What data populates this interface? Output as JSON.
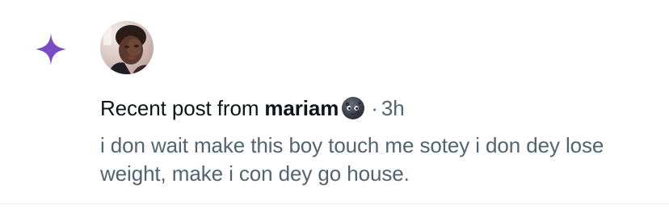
{
  "notification": {
    "headline_prefix": "Recent post from",
    "author_name": "mariam",
    "author_emoji_icon": "new-moon-face-icon",
    "separator": "·",
    "time_ago": "3h",
    "post_text": "i don wait make this boy touch me sotey i don dey lose weight, make i con dey go house.",
    "type_icon": "sparkle-icon",
    "avatar_alt": "mariam"
  },
  "colors": {
    "accent": "#794bc4",
    "primary_text": "#0f1419",
    "secondary_text": "#536471",
    "divider": "#eff3f4",
    "background": "#ffffff"
  }
}
